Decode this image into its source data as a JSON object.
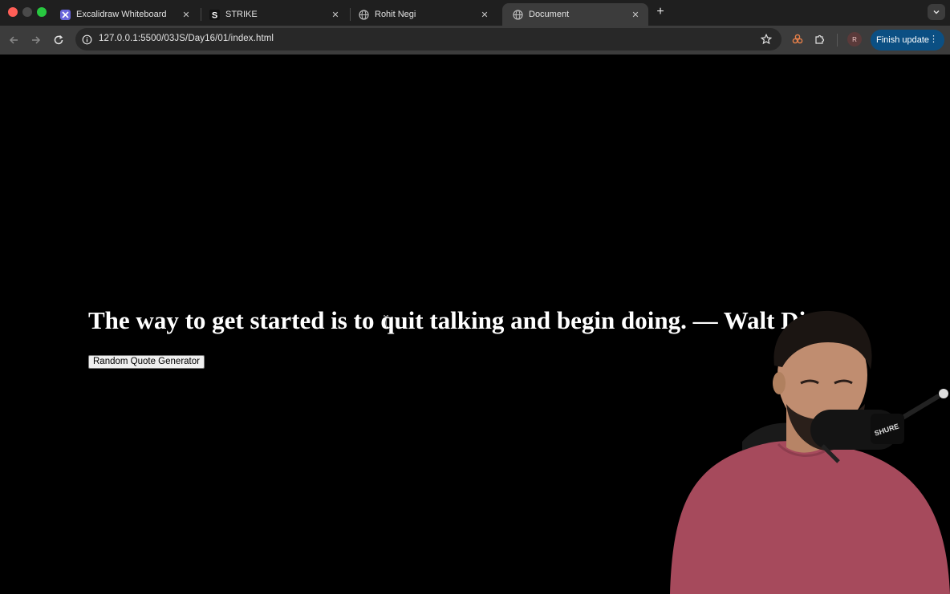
{
  "browser": {
    "tabs": [
      {
        "title": "Excalidraw Whiteboard",
        "icon": "excalidraw-icon",
        "active": false
      },
      {
        "title": "STRIKE",
        "icon": "strike-icon",
        "active": false
      },
      {
        "title": "Rohit Negi",
        "icon": "globe-icon",
        "active": false
      },
      {
        "title": "Document",
        "icon": "globe-icon",
        "active": true
      }
    ],
    "address": "127.0.0.1:5500/03JS/Day16/01/index.html",
    "profile_initial": "R",
    "finish_update_label": "Finish update"
  },
  "page": {
    "quote_text": "The way to get started is to quit talking and begin doing. — Walt Disney",
    "button_label": "Random Quote Generator"
  },
  "colors": {
    "page_background": "#000000",
    "tab_strip": "#1f1f1f",
    "toolbar": "#3c3c3c",
    "finish_button": "#0b4f83"
  }
}
